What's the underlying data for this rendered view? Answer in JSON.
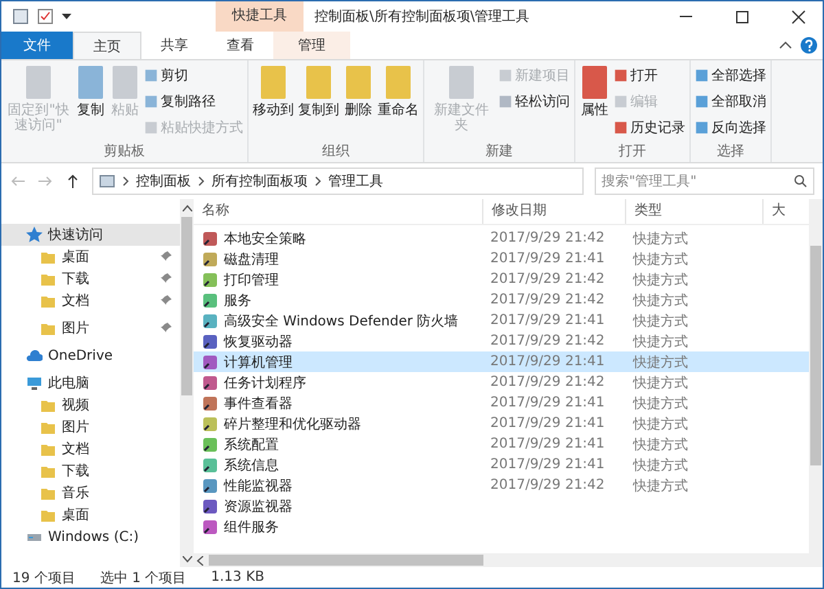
{
  "window": {
    "title": "控制面板\\所有控制面板项\\管理工具",
    "context_tab": "快捷工具"
  },
  "ribbon_tabs": [
    {
      "label": "文件",
      "kind": "file",
      "selected": false
    },
    {
      "label": "主页",
      "kind": "tab",
      "selected": true
    },
    {
      "label": "共享",
      "kind": "tab",
      "selected": false
    },
    {
      "label": "查看",
      "kind": "tab",
      "selected": false
    },
    {
      "label": "管理",
      "kind": "tab",
      "selected": false
    }
  ],
  "ribbon_groups": [
    {
      "label": "剪贴板",
      "commands": [
        {
          "label": "固定到\"快速访问\"",
          "kind": "large",
          "disabled": true
        },
        {
          "label": "复制",
          "kind": "large",
          "disabled": false
        },
        {
          "label": "粘贴",
          "kind": "large",
          "disabled": true
        },
        {
          "label": "剪切",
          "kind": "small",
          "disabled": false
        },
        {
          "label": "复制路径",
          "kind": "small",
          "disabled": false
        },
        {
          "label": "粘贴快捷方式",
          "kind": "small",
          "disabled": true
        }
      ]
    },
    {
      "label": "组织",
      "commands": [
        {
          "label": "移动到",
          "kind": "large",
          "disabled": false
        },
        {
          "label": "复制到",
          "kind": "large",
          "disabled": false
        },
        {
          "label": "删除",
          "kind": "large",
          "disabled": false
        },
        {
          "label": "重命名",
          "kind": "large",
          "disabled": false
        }
      ]
    },
    {
      "label": "新建",
      "commands": [
        {
          "label": "新建文件夹",
          "kind": "large",
          "disabled": true
        },
        {
          "label": "新建项目",
          "kind": "small",
          "disabled": true
        },
        {
          "label": "轻松访问",
          "kind": "small",
          "disabled": false
        }
      ]
    },
    {
      "label": "打开",
      "commands": [
        {
          "label": "属性",
          "kind": "large",
          "disabled": false
        },
        {
          "label": "打开",
          "kind": "small",
          "disabled": false
        },
        {
          "label": "编辑",
          "kind": "small",
          "disabled": true
        },
        {
          "label": "历史记录",
          "kind": "small",
          "disabled": false
        }
      ]
    },
    {
      "label": "选择",
      "commands": [
        {
          "label": "全部选择",
          "kind": "small",
          "disabled": false
        },
        {
          "label": "全部取消",
          "kind": "small",
          "disabled": false
        },
        {
          "label": "反向选择",
          "kind": "small",
          "disabled": false
        }
      ]
    }
  ],
  "address": {
    "segments": [
      "控制面板",
      "所有控制面板项",
      "管理工具"
    ],
    "search_placeholder": "搜索\"管理工具\""
  },
  "nav": [
    {
      "label": "快速访问",
      "kind": "star",
      "selected": true,
      "children": [
        {
          "label": "桌面",
          "kind": "folder",
          "pinned": true
        },
        {
          "label": "下载",
          "kind": "folder",
          "pinned": true
        },
        {
          "label": "文档",
          "kind": "folder",
          "pinned": true
        },
        {
          "label": "图片",
          "kind": "folder",
          "pinned": true
        }
      ]
    },
    {
      "label": "OneDrive",
      "kind": "cloud",
      "selected": false
    },
    {
      "label": "此电脑",
      "kind": "pc",
      "selected": false,
      "children": [
        {
          "label": "视频",
          "kind": "folder",
          "pinned": false
        },
        {
          "label": "图片",
          "kind": "folder",
          "pinned": false
        },
        {
          "label": "文档",
          "kind": "folder",
          "pinned": false
        },
        {
          "label": "下载",
          "kind": "folder",
          "pinned": false
        },
        {
          "label": "音乐",
          "kind": "folder",
          "pinned": false
        },
        {
          "label": "桌面",
          "kind": "folder",
          "pinned": false
        }
      ]
    },
    {
      "label": "Windows (C:)",
      "kind": "drive",
      "selected": false
    }
  ],
  "table": {
    "columns": [
      "名称",
      "修改日期",
      "类型",
      "大"
    ],
    "rows": [
      {
        "name": "本地安全策略",
        "modified": "2017/9/29 21:42",
        "type": "快捷方式",
        "selected": false
      },
      {
        "name": "磁盘清理",
        "modified": "2017/9/29 21:41",
        "type": "快捷方式",
        "selected": false
      },
      {
        "name": "打印管理",
        "modified": "2017/9/29 21:42",
        "type": "快捷方式",
        "selected": false
      },
      {
        "name": "服务",
        "modified": "2017/9/29 21:42",
        "type": "快捷方式",
        "selected": false
      },
      {
        "name": "高级安全 Windows Defender 防火墙",
        "modified": "2017/9/29 21:41",
        "type": "快捷方式",
        "selected": false
      },
      {
        "name": "恢复驱动器",
        "modified": "2017/9/29 21:42",
        "type": "快捷方式",
        "selected": false
      },
      {
        "name": "计算机管理",
        "modified": "2017/9/29 21:41",
        "type": "快捷方式",
        "selected": true
      },
      {
        "name": "任务计划程序",
        "modified": "2017/9/29 21:42",
        "type": "快捷方式",
        "selected": false
      },
      {
        "name": "事件查看器",
        "modified": "2017/9/29 21:41",
        "type": "快捷方式",
        "selected": false
      },
      {
        "name": "碎片整理和优化驱动器",
        "modified": "2017/9/29 21:41",
        "type": "快捷方式",
        "selected": false
      },
      {
        "name": "系统配置",
        "modified": "2017/9/29 21:41",
        "type": "快捷方式",
        "selected": false
      },
      {
        "name": "系统信息",
        "modified": "2017/9/29 21:41",
        "type": "快捷方式",
        "selected": false
      },
      {
        "name": "性能监视器",
        "modified": "2017/9/29 21:42",
        "type": "快捷方式",
        "selected": false
      },
      {
        "name": "资源监视器",
        "selected": false
      },
      {
        "name": "组件服务",
        "selected": false
      }
    ]
  },
  "status_bar": {
    "count": "19 个项目",
    "selection": "选中 1 个项目",
    "size": "1.13 KB"
  }
}
